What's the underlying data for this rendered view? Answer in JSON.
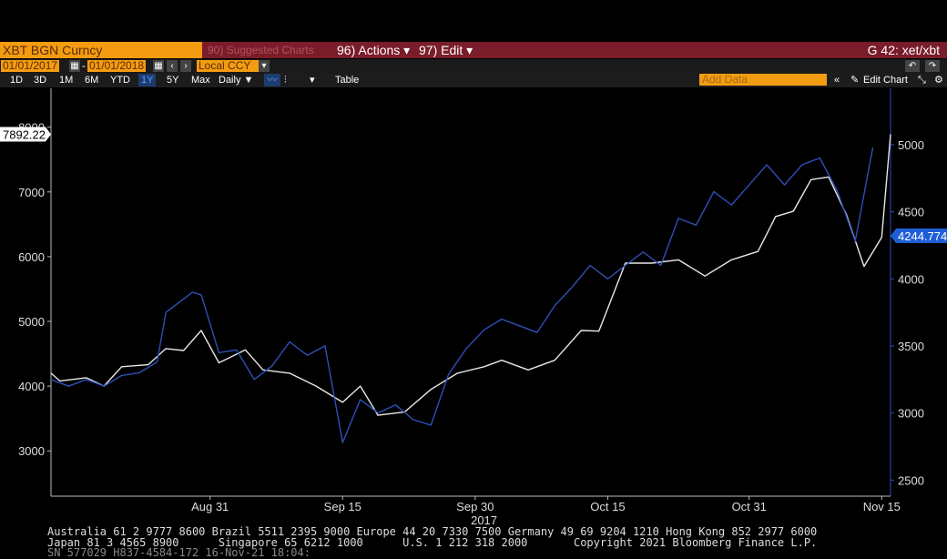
{
  "header": {
    "security": "XBT BGN Curncy",
    "suggested": "90) Suggested Charts",
    "actions": "96) Actions ▾",
    "edit": "97) Edit ▾",
    "graph_id": "G 42: xet/xbt"
  },
  "controls": {
    "start_date": "01/01/2017",
    "end_date": "01/01/2018",
    "currency": "Local CCY",
    "periods": [
      "1D",
      "3D",
      "1M",
      "6M",
      "YTD",
      "1Y",
      "5Y",
      "Max"
    ],
    "active_period": "1Y",
    "frequency": "Daily ▼",
    "table_label": "Table",
    "add_data_placeholder": "Add Data",
    "edit_chart": "Edit Chart"
  },
  "footer": {
    "line1": "Australia 61 2 9777 8600 Brazil 5511 2395 9000 Europe 44 20 7330 7500 Germany 49 69 9204 1210 Hong Kong 852 2977 6000",
    "line2": "Japan 81 3 4565 8900      Singapore 65 6212 1000      U.S. 1 212 318 2000       Copyright 2021 Bloomberg Finance L.P.",
    "line3": "SN 577029 H837-4584-172 16-Nov-21 18:04:"
  },
  "colors": {
    "white_series": "#e8e8e8",
    "blue_series": "#2f4fb8",
    "accent": "#f39c12",
    "header_bar": "#7a1c2a"
  },
  "chart_data": {
    "type": "line",
    "left_axis": {
      "ticks": [
        3000,
        4000,
        5000,
        6000,
        7000,
        8000
      ],
      "range": [
        2300,
        8600
      ]
    },
    "right_axis": {
      "ticks": [
        2500,
        3000,
        3500,
        4000,
        4500,
        5000
      ],
      "range": [
        2380,
        5420
      ]
    },
    "x_ticks": [
      "Aug 31",
      "Sep 15",
      "Sep 30",
      "Oct 15",
      "Oct 31",
      "Nov 15"
    ],
    "x_year_label": "2017",
    "last_values": {
      "white": "7892.22",
      "blue": "4244.774"
    },
    "series": [
      {
        "axis": "left",
        "color": "#e8e8e8",
        "dates": [
          "2017-08-13",
          "2017-08-14",
          "2017-08-17",
          "2017-08-19",
          "2017-08-21",
          "2017-08-24",
          "2017-08-26",
          "2017-08-28",
          "2017-08-30",
          "2017-09-01",
          "2017-09-04",
          "2017-09-06",
          "2017-09-09",
          "2017-09-12",
          "2017-09-15",
          "2017-09-17",
          "2017-09-19",
          "2017-09-22",
          "2017-09-25",
          "2017-09-28",
          "2017-10-01",
          "2017-10-03",
          "2017-10-06",
          "2017-10-09",
          "2017-10-12",
          "2017-10-14",
          "2017-10-17",
          "2017-10-20",
          "2017-10-23",
          "2017-10-26",
          "2017-10-29",
          "2017-11-01",
          "2017-11-03",
          "2017-11-05",
          "2017-11-07",
          "2017-11-09",
          "2017-11-11",
          "2017-11-13",
          "2017-11-15",
          "2017-11-16"
        ],
        "values": [
          4200,
          4080,
          4130,
          4000,
          4300,
          4330,
          4580,
          4550,
          4860,
          4360,
          4560,
          4250,
          4200,
          4000,
          3750,
          4000,
          3550,
          3600,
          3950,
          4200,
          4300,
          4400,
          4250,
          4400,
          4860,
          4850,
          5900,
          5900,
          5950,
          5700,
          5950,
          6080,
          6620,
          6700,
          7190,
          7230,
          6650,
          5850,
          6300,
          7890
        ]
      },
      {
        "axis": "right",
        "color": "#2f4fb8",
        "dates": [
          "2017-08-13",
          "2017-08-15",
          "2017-08-17",
          "2017-08-19",
          "2017-08-21",
          "2017-08-23",
          "2017-08-25",
          "2017-08-26",
          "2017-08-28",
          "2017-08-29",
          "2017-08-30",
          "2017-09-01",
          "2017-09-03",
          "2017-09-05",
          "2017-09-07",
          "2017-09-09",
          "2017-09-11",
          "2017-09-13",
          "2017-09-15",
          "2017-09-17",
          "2017-09-19",
          "2017-09-21",
          "2017-09-23",
          "2017-09-25",
          "2017-09-27",
          "2017-09-29",
          "2017-10-01",
          "2017-10-03",
          "2017-10-05",
          "2017-10-07",
          "2017-10-09",
          "2017-10-11",
          "2017-10-13",
          "2017-10-15",
          "2017-10-17",
          "2017-10-19",
          "2017-10-21",
          "2017-10-23",
          "2017-10-25",
          "2017-10-27",
          "2017-10-29",
          "2017-10-31",
          "2017-11-02",
          "2017-11-04",
          "2017-11-06",
          "2017-11-08",
          "2017-11-10",
          "2017-11-12",
          "2017-11-14"
        ],
        "values": [
          3250,
          3200,
          3250,
          3200,
          3280,
          3300,
          3380,
          3750,
          3850,
          3900,
          3880,
          3450,
          3470,
          3250,
          3350,
          3530,
          3430,
          3500,
          2780,
          3100,
          3000,
          3060,
          2950,
          2910,
          3290,
          3480,
          3620,
          3700,
          3650,
          3600,
          3800,
          3940,
          4100,
          4000,
          4100,
          4200,
          4100,
          4450,
          4400,
          4650,
          4550,
          4700,
          4850,
          4700,
          4850,
          4900,
          4650,
          4280,
          4980
        ]
      }
    ]
  }
}
